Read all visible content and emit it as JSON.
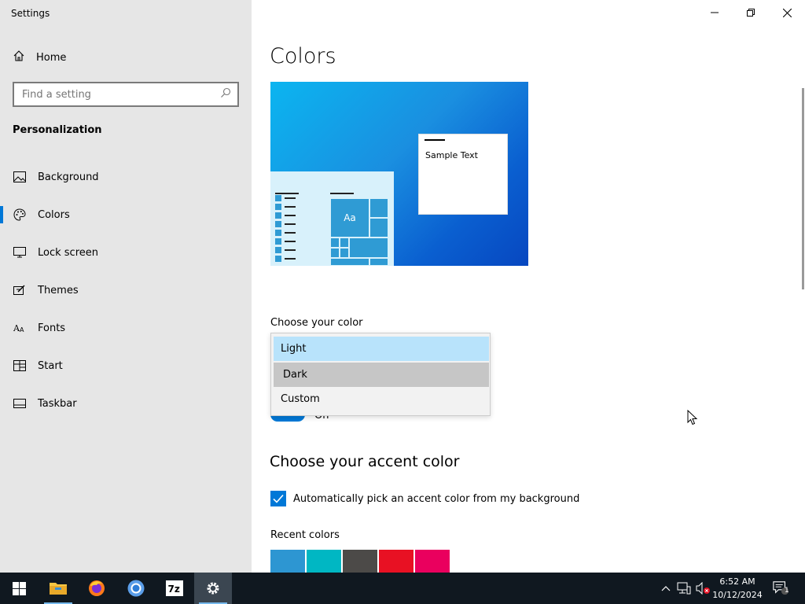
{
  "window": {
    "title": "Settings"
  },
  "sidebar": {
    "home_label": "Home",
    "search_placeholder": "Find a setting",
    "section_title": "Personalization",
    "items": [
      {
        "label": "Background",
        "icon": "picture-icon"
      },
      {
        "label": "Colors",
        "icon": "palette-icon",
        "active": true
      },
      {
        "label": "Lock screen",
        "icon": "lock-screen-icon"
      },
      {
        "label": "Themes",
        "icon": "themes-icon"
      },
      {
        "label": "Fonts",
        "icon": "fonts-icon"
      },
      {
        "label": "Start",
        "icon": "start-icon"
      },
      {
        "label": "Taskbar",
        "icon": "taskbar-icon"
      }
    ]
  },
  "main": {
    "title": "Colors",
    "preview": {
      "sample_text": "Sample Text",
      "tile_label": "Aa"
    },
    "choose_color_label": "Choose your color",
    "color_options": [
      "Light",
      "Dark",
      "Custom"
    ],
    "color_option_hovered": "Light",
    "color_option_selected": "Dark",
    "toggle_text": "On",
    "accent_title": "Choose your accent color",
    "auto_accent_label": "Automatically pick an accent color from my background",
    "auto_accent_checked": true,
    "recent_colors_label": "Recent colors",
    "recent_colors": [
      "#2d96d2",
      "#00b7c3",
      "#4c4a48",
      "#e81123",
      "#ea005e"
    ]
  },
  "taskbar": {
    "apps": [
      {
        "name": "file-explorer",
        "running": true
      },
      {
        "name": "firefox",
        "running": false
      },
      {
        "name": "chromium",
        "running": false
      },
      {
        "name": "7-zip",
        "running": false
      },
      {
        "name": "settings",
        "running": true,
        "active": true
      }
    ],
    "time": "6:52 AM",
    "date": "10/12/2024",
    "notification_count": "1"
  },
  "colors": {
    "accent": "#0078d7",
    "sidebar_bg": "#e6e6e6",
    "taskbar_bg": "#101820"
  }
}
